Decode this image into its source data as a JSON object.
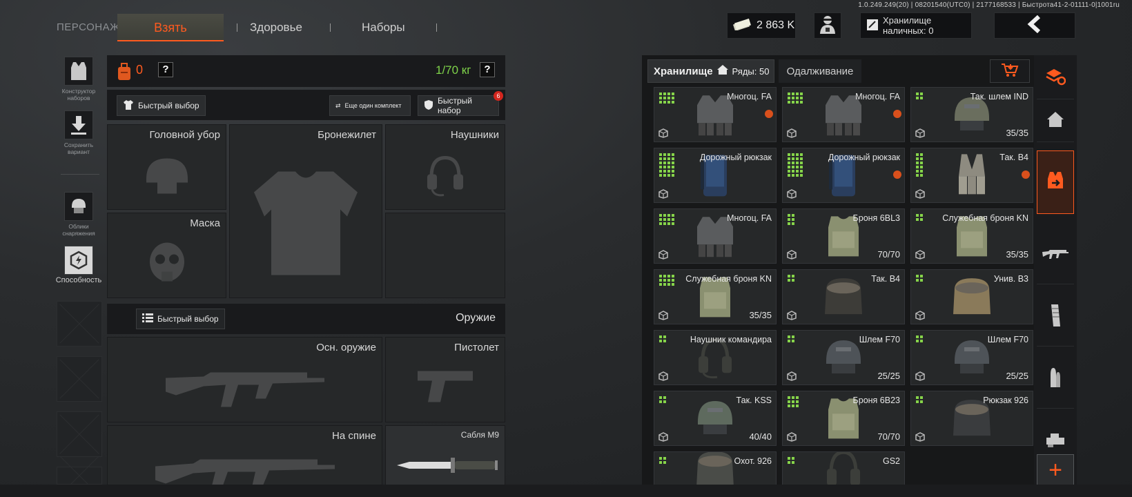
{
  "version": "1.0.249.249(20) | 08201540(UTC0) | 2177168533 | Быстрота41-2-01111-0|1001ru",
  "top_tabs": {
    "persona": "ПЕРСОНАЖ",
    "take": "Взять",
    "health": "Здоровье",
    "sets": "Наборы"
  },
  "header": {
    "money": "2 863 K",
    "cash_storage": "Хранилище наличных: 0"
  },
  "left_rail": {
    "constructor": "Конструктор наборов",
    "save": "Сохранить вариант",
    "skins": "Облики снаряжения",
    "ability": "Способность"
  },
  "status": {
    "count": "0",
    "help": "?",
    "weight": "1/70 кг",
    "help2": "?"
  },
  "quick": {
    "quick_select": "Быстрый выбор",
    "another_set": "Еще один комплект",
    "quick_set": "Быстрый набор",
    "quick_set_badge": "6"
  },
  "slots": {
    "headwear": "Головной убор",
    "armor": "Бронежилет",
    "headphones": "Наушники",
    "mask": "Маска",
    "weapon_quick": "Быстрый выбор",
    "weapon_title": "Оружие",
    "primary": "Осн. оружие",
    "pistol": "Пистолет",
    "back": "На спине",
    "melee": "Сабля M9"
  },
  "storage": {
    "tab": "Хранилище",
    "rows": "Ряды: 50",
    "borrow": "Одалживание",
    "items": [
      {
        "name": "Многоц. FA",
        "dur": "",
        "grid": "4x3",
        "tag": true,
        "kind": "vest"
      },
      {
        "name": "Многоц. FA",
        "dur": "",
        "grid": "4x3",
        "tag": true,
        "kind": "vest"
      },
      {
        "name": "Так. шлем IND",
        "dur": "35/35",
        "grid": "2x2",
        "tag": false,
        "kind": "helmet"
      },
      {
        "name": "Дорожный рюкзак",
        "dur": "",
        "grid": "4x6",
        "tag": false,
        "kind": "pack"
      },
      {
        "name": "Дорожный рюкзак",
        "dur": "",
        "grid": "4x6",
        "tag": true,
        "kind": "pack"
      },
      {
        "name": "Так. B4",
        "dur": "",
        "grid": "2x6",
        "tag": true,
        "kind": "rig"
      },
      {
        "name": "Многоц. FA",
        "dur": "",
        "grid": "4x3",
        "tag": false,
        "kind": "vest"
      },
      {
        "name": "Броня 6BL3",
        "dur": "70/70",
        "grid": "2x3",
        "tag": false,
        "kind": "armor"
      },
      {
        "name": "Служебная броня KN",
        "dur": "35/35",
        "grid": "2x2",
        "tag": false,
        "kind": "armor"
      },
      {
        "name": "Служебная броня KN",
        "dur": "35/35",
        "grid": "4x3",
        "tag": false,
        "kind": "armor"
      },
      {
        "name": "Так. B4",
        "dur": "",
        "grid": "2x2",
        "tag": false,
        "kind": "bag"
      },
      {
        "name": "Унив. B3",
        "dur": "",
        "grid": "2x2",
        "tag": false,
        "kind": "bag"
      },
      {
        "name": "Наушник командира",
        "dur": "",
        "grid": "2x2",
        "tag": false,
        "kind": "headset"
      },
      {
        "name": "Шлем F70",
        "dur": "25/25",
        "grid": "2x2",
        "tag": false,
        "kind": "helmet"
      },
      {
        "name": "Шлем F70",
        "dur": "25/25",
        "grid": "2x2",
        "tag": false,
        "kind": "helmet"
      },
      {
        "name": "Так. KSS",
        "dur": "40/40",
        "grid": "2x2",
        "tag": false,
        "kind": "helmet"
      },
      {
        "name": "Броня 6B23",
        "dur": "70/70",
        "grid": "3x3",
        "tag": false,
        "kind": "armor"
      },
      {
        "name": "Рюкзак 926",
        "dur": "",
        "grid": "2x2",
        "tag": false,
        "kind": "bag"
      },
      {
        "name": "Охот. 926",
        "dur": "",
        "grid": "2x2",
        "tag": false,
        "kind": "bag"
      },
      {
        "name": "GS2",
        "dur": "",
        "grid": "2x2",
        "tag": false,
        "kind": "headset"
      }
    ]
  },
  "categories": [
    "stack-refresh-icon",
    "home-icon",
    "gear-swap-icon",
    "rifle-icon",
    "magazine-icon",
    "ammo-icon",
    "scope-icon"
  ],
  "add_label": "+",
  "colors": {
    "accent": "#ff5a1f",
    "grid_green": "#86d44a",
    "weight_green": "#7fd44a"
  }
}
